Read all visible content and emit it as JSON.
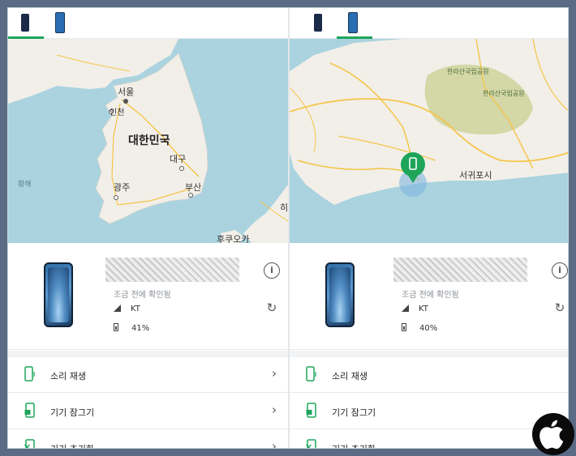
{
  "left": {
    "map_labels": {
      "seoul": "서울",
      "incheon": "인천",
      "korea": "대한민국",
      "daegu": "대구",
      "gwangju": "광주",
      "busan": "부산",
      "hwanghae": "황해",
      "hiro": "히로",
      "fukuoka": "후쿠오카"
    },
    "status": "조금 전에 확인됨",
    "carrier": "KT",
    "battery": "41%",
    "menu": [
      "소리 재생",
      "기기 잠그기",
      "기기 초기화"
    ]
  },
  "right": {
    "map_labels": {
      "park1": "한라산국립공원",
      "park2": "한라산국립공원",
      "seogwipo": "서귀포시"
    },
    "status": "조금 전에 확인됨",
    "carrier": "KT",
    "battery": "40%",
    "menu": [
      "소리 재생",
      "기기 잠그기",
      "기기 초기화"
    ]
  },
  "icons": {
    "info": "info-icon",
    "refresh": "refresh-icon",
    "play_sound": "play-sound-icon",
    "lock": "lock-device-icon",
    "erase": "erase-device-icon",
    "chevron": "chevron-right-icon",
    "signal": "signal-icon",
    "battery": "battery-icon",
    "apple": "apple-logo-icon"
  },
  "colors": {
    "accent_green": "#1ea55a",
    "background": "#5b6b85",
    "sea": "#aad3df",
    "land": "#f2efe9",
    "road": "#f5c54a",
    "park": "#c9cf8f"
  }
}
